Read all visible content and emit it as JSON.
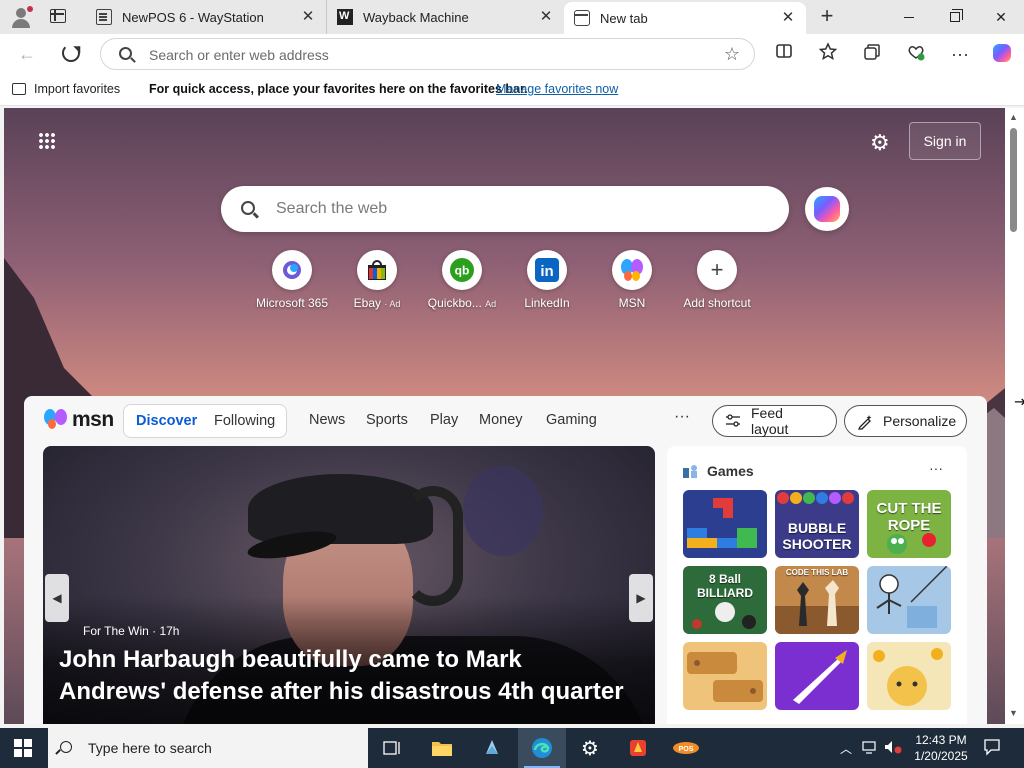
{
  "browser": {
    "tabs": [
      {
        "title": "NewPOS 6 - WayStation",
        "icon": "document-icon"
      },
      {
        "title": "Wayback Machine",
        "icon": "wayback-icon"
      },
      {
        "title": "New tab",
        "icon": "new-tab-icon",
        "active": true
      }
    ],
    "new_tab_symbol": "+",
    "address_placeholder": "Search or enter web address",
    "favorites_bar": {
      "import_label": "Import favorites",
      "message": "For quick access, place your favorites here on the favorites bar.",
      "manage_link": "Manage favorites now"
    }
  },
  "newtab": {
    "signin_label": "Sign in",
    "search_placeholder": "Search the web",
    "shortcuts": [
      {
        "label": "Microsoft 365",
        "ad": ""
      },
      {
        "label": "Ebay",
        "ad": "· Ad"
      },
      {
        "label": "Quickbo...",
        "ad": "Ad"
      },
      {
        "label": "LinkedIn",
        "ad": ""
      },
      {
        "label": "MSN",
        "ad": ""
      },
      {
        "label": "Add shortcut",
        "ad": ""
      }
    ]
  },
  "msn": {
    "logo": "msn",
    "tabs": {
      "discover": "Discover",
      "following": "Following"
    },
    "nav": [
      "News",
      "Sports",
      "Play",
      "Money",
      "Gaming"
    ],
    "more": "···",
    "feed_layout": "Feed layout",
    "personalize": "Personalize",
    "hero": {
      "source": "For The Win · 17h",
      "headline": "John Harbaugh beautifully came to Mark Andrews' defense after his disastrous 4th quarter"
    },
    "games": {
      "title": "Games",
      "more": "···",
      "tiles": [
        {
          "label": "",
          "color": "#2c3e8f"
        },
        {
          "label": "BUBBLE SHOOTER",
          "color": "#3b3b8a"
        },
        {
          "label": "CUT THE ROPE",
          "color": "#7cb342"
        },
        {
          "label": "8 Ball BILLIARD",
          "color": "#2e6b3a"
        },
        {
          "label": "CODE THIS LAB",
          "color": "#c2894b"
        },
        {
          "label": "",
          "color": "#a6c8e6"
        },
        {
          "label": "",
          "color": "#f0c37a"
        },
        {
          "label": "",
          "color": "#7b2fd1"
        },
        {
          "label": "",
          "color": "#f5e6b8"
        }
      ]
    }
  },
  "taskbar": {
    "search_placeholder": "Type here to search",
    "time": "12:43 PM",
    "date": "1/20/2025"
  }
}
